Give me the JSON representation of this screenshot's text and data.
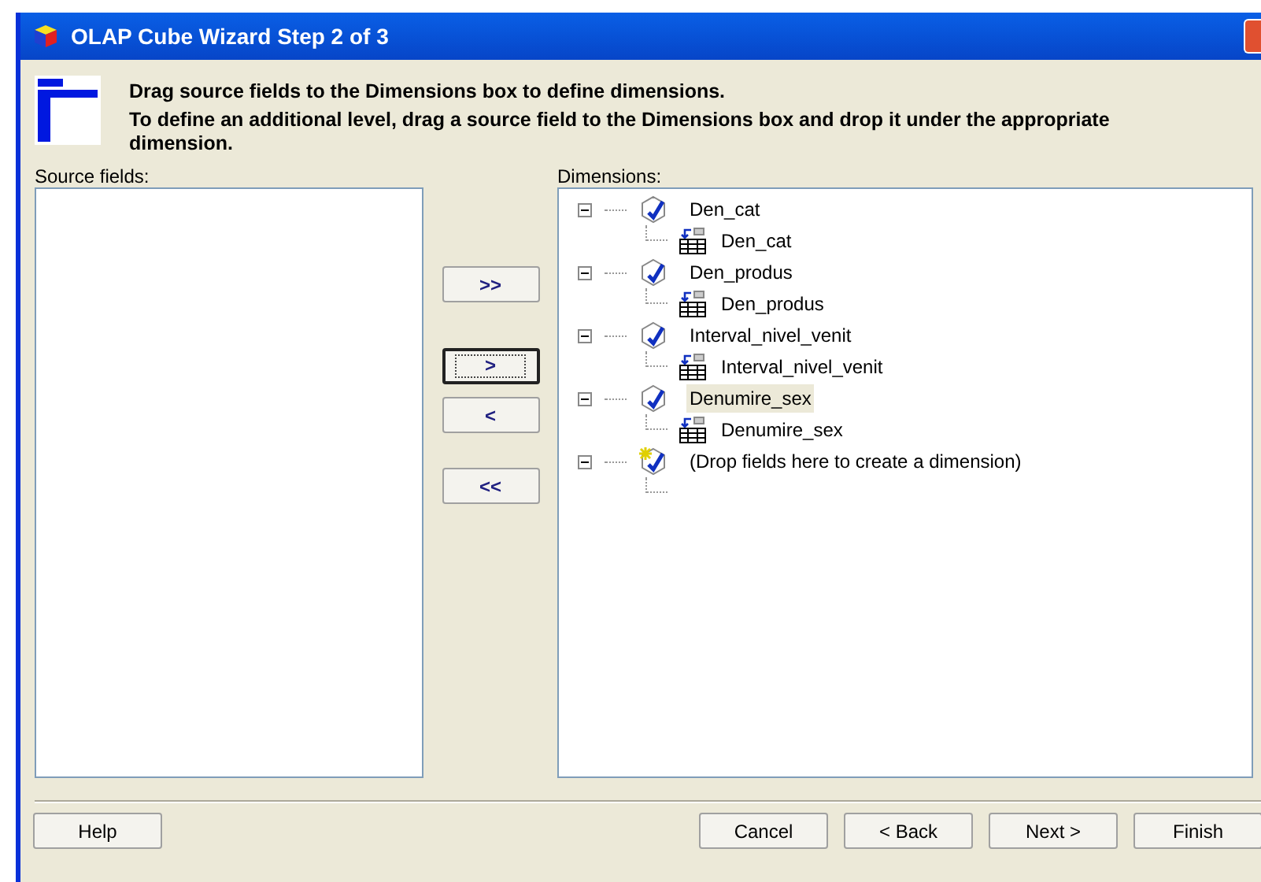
{
  "window": {
    "title": "OLAP Cube Wizard Step 2 of 3"
  },
  "instructions": [
    "Drag source fields to the Dimensions box to define dimensions.",
    "To define an additional level, drag a source field to the Dimensions box and drop it under the appropriate dimension."
  ],
  "source_fields": {
    "label": "Source fields:"
  },
  "move_buttons": [
    {
      "label": ">>",
      "focused": false
    },
    {
      "label": ">",
      "focused": true
    },
    {
      "label": "<",
      "focused": false
    },
    {
      "label": "<<",
      "focused": false
    }
  ],
  "dimensions": {
    "label": "Dimensions:",
    "tree": [
      {
        "label": "Den_cat",
        "kind": "dimension",
        "expanded": true,
        "selected": false,
        "children": [
          {
            "label": "Den_cat"
          }
        ]
      },
      {
        "label": "Den_produs",
        "kind": "dimension",
        "expanded": true,
        "selected": false,
        "children": [
          {
            "label": "Den_produs"
          }
        ]
      },
      {
        "label": "Interval_nivel_venit",
        "kind": "dimension",
        "expanded": true,
        "selected": false,
        "children": [
          {
            "label": "Interval_nivel_venit"
          }
        ]
      },
      {
        "label": "Denumire_sex",
        "kind": "dimension",
        "expanded": true,
        "selected": true,
        "children": [
          {
            "label": "Denumire_sex"
          }
        ]
      },
      {
        "label": "(Drop fields here to create a dimension)",
        "kind": "new",
        "expanded": true,
        "selected": false
      }
    ]
  },
  "footer_buttons": [
    {
      "label": "Help"
    },
    {
      "label": "Cancel"
    },
    {
      "label": "< Back"
    },
    {
      "label": "Next >"
    },
    {
      "label": "Finish"
    }
  ]
}
